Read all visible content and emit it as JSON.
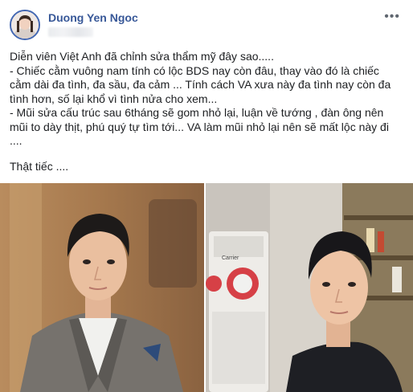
{
  "post": {
    "author": "Duong Yen Ngoc",
    "more_icon": "more-horizontal-icon",
    "text_lines": [
      "Diễn viên Việt Anh đã chỉnh sửa thẩm mỹ đây sao.....",
      "- Chiếc cằm vuông nam tính có lộc BDS nay còn đâu, thay vào đó là chiếc",
      "cằm dài đa tình, đa sầu, đa cảm ... Tính cách VA xưa này đa tình nay còn đa",
      "tình hơn, số lại khổ vì tình nửa cho xem...",
      "- Mũi sửa cấu trúc sau 6tháng sẽ gom nhỏ lại, luận về tướng , đàn ông nên",
      "mũi to dày thịt, phú quý tự tìm tới... VA làm mũi nhỏ lại nên sẽ mất lộc này đi",
      "...."
    ],
    "closing": "Thật tiếc ....",
    "photos": {
      "right_appliance_brand": "Carrier"
    }
  },
  "colors": {
    "author": "#385898",
    "text": "#1c1e21",
    "avatar_ring": "#4267b2"
  }
}
